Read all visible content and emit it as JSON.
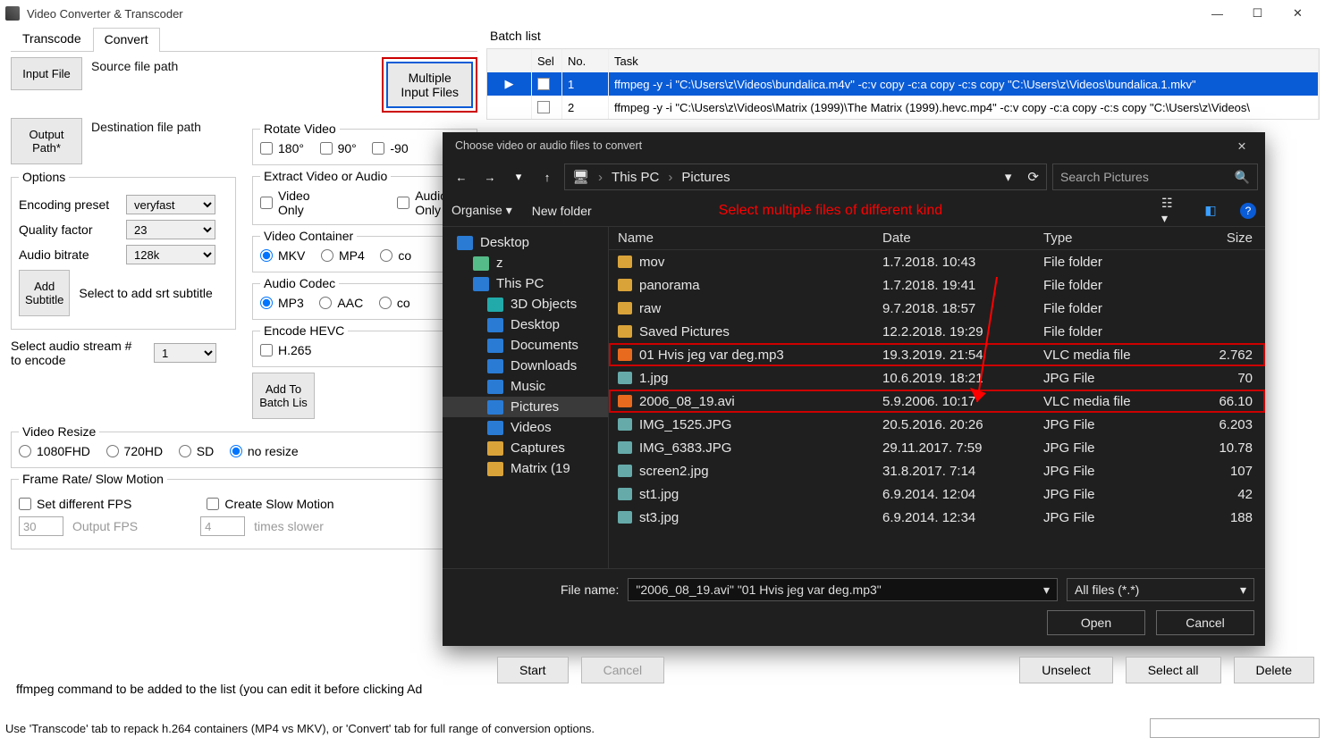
{
  "app": {
    "title": "Video Converter & Transcoder"
  },
  "winbuttons": {
    "min": "—",
    "max": "▢",
    "close": "✕"
  },
  "tabs": {
    "transcode": "Transcode",
    "convert": "Convert"
  },
  "left": {
    "input_file_btn": "Input File",
    "source_label": "Source file path",
    "multi_btn_l1": "Multiple",
    "multi_btn_l2": "Input Files",
    "output_btn_l1": "Output",
    "output_btn_l2": "Path*",
    "dest_label": "Destination file path",
    "rotate_legend": "Rotate Video",
    "rot180": "180°",
    "rot90": "90°",
    "rotn90": "-90",
    "extract_legend": "Extract Video or Audio",
    "video_only": "Video\nOnly",
    "audio_only": "Audio\nOnly",
    "options_legend": "Options",
    "enc_preset_lbl": "Encoding preset",
    "enc_preset_val": "veryfast",
    "quality_lbl": "Quality factor",
    "quality_val": "23",
    "abitrate_lbl": "Audio bitrate",
    "abitrate_val": "128k",
    "add_sub_l1": "Add",
    "add_sub_l2": "Subtitle",
    "sub_hint": "Select to add srt subtitle",
    "vcont_legend": "Video Container",
    "mkv": "MKV",
    "mp4": "MP4",
    "co": "co",
    "acodec_legend": "Audio Codec",
    "mp3": "MP3",
    "aac": "AAC",
    "hevc_legend": "Encode HEVC",
    "h265": "H.265",
    "audio_stream_lbl_l1": "Select audio stream #",
    "audio_stream_lbl_l2": "to encode",
    "audio_stream_val": "1",
    "add_batch_l1": "Add To",
    "add_batch_l2": "Batch Lis",
    "resize_legend": "Video Resize",
    "r1080": "1080FHD",
    "r720": "720HD",
    "rsd": "SD",
    "rnone": "no resize",
    "fps_legend": "Frame Rate/ Slow Motion",
    "set_fps": "Set different FPS",
    "create_slow": "Create Slow Motion",
    "fps_val": "30",
    "fps_ph": "Output FPS",
    "slow_val": "4",
    "slow_ph": "times slower",
    "cmd_note": "ffmpeg command to be added to the list (you can edit it before clicking Ad"
  },
  "batch": {
    "title": "Batch list",
    "cols": {
      "sel": "Sel",
      "no": "No.",
      "task": "Task"
    },
    "rows": [
      {
        "no": "1",
        "task": "ffmpeg -y -i \"C:\\Users\\z\\Videos\\bundalica.m4v\" -c:v copy -c:a copy -c:s copy \"C:\\Users\\z\\Videos\\bundalica.1.mkv\"",
        "selected": true
      },
      {
        "no": "2",
        "task": "ffmpeg -y -i \"C:\\Users\\z\\Videos\\Matrix (1999)\\The Matrix (1999).hevc.mp4\" -c:v copy -c:a copy -c:s copy \"C:\\Users\\z\\Videos\\",
        "selected": false
      }
    ]
  },
  "dialog": {
    "title": "Choose video or audio files to convert",
    "breadcrumb": {
      "root": "This PC",
      "leaf": "Pictures"
    },
    "search_ph": "Search Pictures",
    "organise": "Organise ▾",
    "new_folder": "New folder",
    "annotation": "Select multiple files of different kind",
    "tree": [
      {
        "label": "Desktop",
        "class": "ic-desktop",
        "lvl": 0
      },
      {
        "label": "z",
        "class": "ic-user",
        "lvl": 1
      },
      {
        "label": "This PC",
        "class": "ic-pc",
        "lvl": 1
      },
      {
        "label": "3D Objects",
        "class": "ic-3d",
        "lvl": 2
      },
      {
        "label": "Desktop",
        "class": "ic-desktop",
        "lvl": 2
      },
      {
        "label": "Documents",
        "class": "ic-doc",
        "lvl": 2
      },
      {
        "label": "Downloads",
        "class": "ic-dl",
        "lvl": 2
      },
      {
        "label": "Music",
        "class": "ic-mus",
        "lvl": 2
      },
      {
        "label": "Pictures",
        "class": "ic-pic",
        "lvl": 2,
        "sel": true
      },
      {
        "label": "Videos",
        "class": "ic-vid",
        "lvl": 2
      },
      {
        "label": "Captures",
        "class": "ic-fold",
        "lvl": 2
      },
      {
        "label": "Matrix (19",
        "class": "ic-fold",
        "lvl": 2
      }
    ],
    "cols": {
      "name": "Name",
      "date": "Date",
      "type": "Type",
      "size": "Size"
    },
    "files": [
      {
        "name": "mov",
        "date": "1.7.2018. 10:43",
        "type": "File folder",
        "size": "",
        "icon": "fold"
      },
      {
        "name": "panorama",
        "date": "1.7.2018. 19:41",
        "type": "File folder",
        "size": "",
        "icon": "fold"
      },
      {
        "name": "raw",
        "date": "9.7.2018. 18:57",
        "type": "File folder",
        "size": "",
        "icon": "fold"
      },
      {
        "name": "Saved Pictures",
        "date": "12.2.2018. 19:29",
        "type": "File folder",
        "size": "",
        "icon": "fold"
      },
      {
        "name": "01 Hvis jeg var deg.mp3",
        "date": "19.3.2019. 21:54",
        "type": "VLC media file",
        "size": "2.762",
        "icon": "vlc",
        "hl": true
      },
      {
        "name": "1.jpg",
        "date": "10.6.2019. 18:21",
        "type": "JPG File",
        "size": "70",
        "icon": "img"
      },
      {
        "name": "2006_08_19.avi",
        "date": "5.9.2006. 10:17",
        "type": "VLC media file",
        "size": "66.10",
        "icon": "vlc",
        "hl": true
      },
      {
        "name": "IMG_1525.JPG",
        "date": "20.5.2016. 20:26",
        "type": "JPG File",
        "size": "6.203",
        "icon": "img"
      },
      {
        "name": "IMG_6383.JPG",
        "date": "29.11.2017. 7:59",
        "type": "JPG File",
        "size": "10.78",
        "icon": "img"
      },
      {
        "name": "screen2.jpg",
        "date": "31.8.2017. 7:14",
        "type": "JPG File",
        "size": "107",
        "icon": "img"
      },
      {
        "name": "st1.jpg",
        "date": "6.9.2014. 12:04",
        "type": "JPG File",
        "size": "42",
        "icon": "img"
      },
      {
        "name": "st3.jpg",
        "date": "6.9.2014. 12:34",
        "type": "JPG File",
        "size": "188",
        "icon": "img"
      }
    ],
    "file_name_lbl": "File name:",
    "file_name_val": "\"2006_08_19.avi\" \"01 Hvis jeg var deg.mp3\"",
    "filter": "All files (*.*)",
    "open": "Open",
    "cancel": "Cancel"
  },
  "bottom": {
    "start": "Start",
    "cancel": "Cancel",
    "unselect": "Unselect",
    "select_all": "Select all",
    "delete": "Delete"
  },
  "status": "Use 'Transcode' tab to repack h.264 containers (MP4 vs MKV), or 'Convert' tab for full range of conversion options."
}
